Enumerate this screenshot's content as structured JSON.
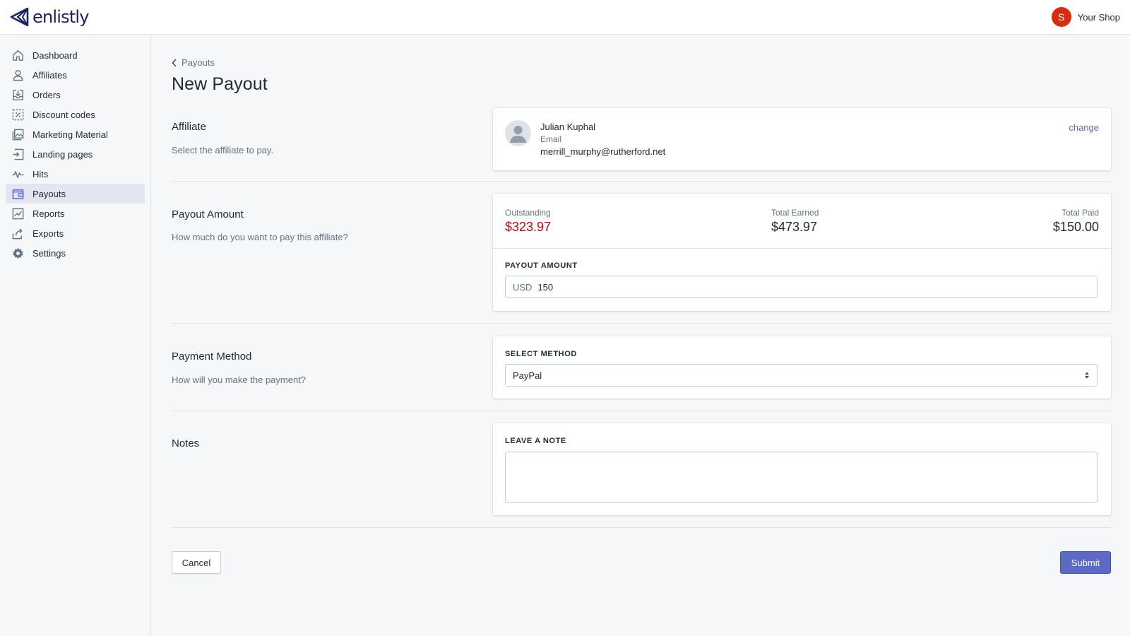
{
  "app": {
    "brand": "enlistly",
    "shop_initial": "S",
    "shop_name": "Your Shop",
    "accent_color": "#5c6ac4",
    "avatar_color": "#d82c0d"
  },
  "sidebar": {
    "items": [
      {
        "label": "Dashboard",
        "icon": "home-icon"
      },
      {
        "label": "Affiliates",
        "icon": "person-icon"
      },
      {
        "label": "Orders",
        "icon": "orders-icon"
      },
      {
        "label": "Discount codes",
        "icon": "discount-icon"
      },
      {
        "label": "Marketing Material",
        "icon": "image-icon"
      },
      {
        "label": "Landing pages",
        "icon": "landing-icon"
      },
      {
        "label": "Hits",
        "icon": "activity-icon"
      },
      {
        "label": "Payouts",
        "icon": "wallet-icon",
        "active": true
      },
      {
        "label": "Reports",
        "icon": "chart-icon"
      },
      {
        "label": "Exports",
        "icon": "export-icon"
      },
      {
        "label": "Settings",
        "icon": "gear-icon"
      }
    ]
  },
  "page": {
    "breadcrumb": "Payouts",
    "title": "New Payout"
  },
  "affiliate": {
    "title": "Affiliate",
    "description": "Select the affiliate to pay.",
    "name": "Julian Kuphal",
    "email_label": "Email",
    "email": "merrill_murphy@rutherford.net",
    "change_label": "change"
  },
  "payout_amount": {
    "title": "Payout Amount",
    "description": "How much do you want to pay this affiliate?",
    "outstanding_label": "Outstanding",
    "outstanding_value": "$323.97",
    "total_earned_label": "Total Earned",
    "total_earned_value": "$473.97",
    "total_paid_label": "Total Paid",
    "total_paid_value": "$150.00",
    "field_label": "PAYOUT AMOUNT",
    "currency": "USD",
    "value": "150"
  },
  "payment_method": {
    "title": "Payment Method",
    "description": "How will you make the payment?",
    "field_label": "SELECT METHOD",
    "selected": "PayPal"
  },
  "notes": {
    "title": "Notes",
    "field_label": "LEAVE A NOTE",
    "value": ""
  },
  "actions": {
    "cancel": "Cancel",
    "submit": "Submit"
  }
}
